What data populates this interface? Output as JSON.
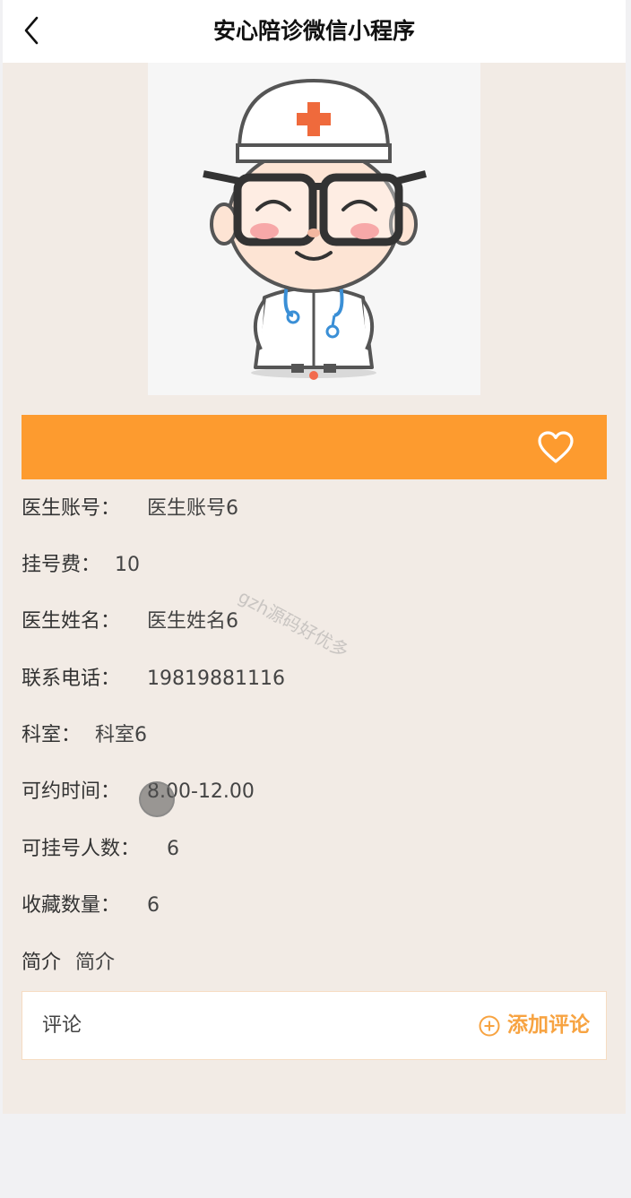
{
  "header": {
    "title": "安心陪诊微信小程序",
    "back_icon": "chevron-left-icon"
  },
  "doctor_image": {
    "description_icon": "doctor-cartoon-icon"
  },
  "action_bar": {
    "color": "#fd9b2f",
    "favorite_icon": "heart-icon"
  },
  "info": {
    "account": {
      "label": "医生账号：",
      "value": "医生账号6"
    },
    "fee": {
      "label": "挂号费：",
      "value": "10"
    },
    "name": {
      "label": "医生姓名：",
      "value": "医生姓名6"
    },
    "phone": {
      "label": "联系电话：",
      "value": "19819881116"
    },
    "department": {
      "label": "科室：",
      "value": "科室6"
    },
    "time": {
      "label": "可约时间：",
      "value": "8.00-12.00"
    },
    "capacity": {
      "label": "可挂号人数：",
      "value": "6"
    },
    "favorites": {
      "label": "收藏数量：",
      "value": "6"
    },
    "intro": {
      "label": "简介",
      "value": "简介"
    }
  },
  "watermark": "gzh源码好优多",
  "comments": {
    "label": "评论",
    "add_label": "添加评论",
    "accent": "#f7a341",
    "add_icon": "plus-circle-icon"
  }
}
